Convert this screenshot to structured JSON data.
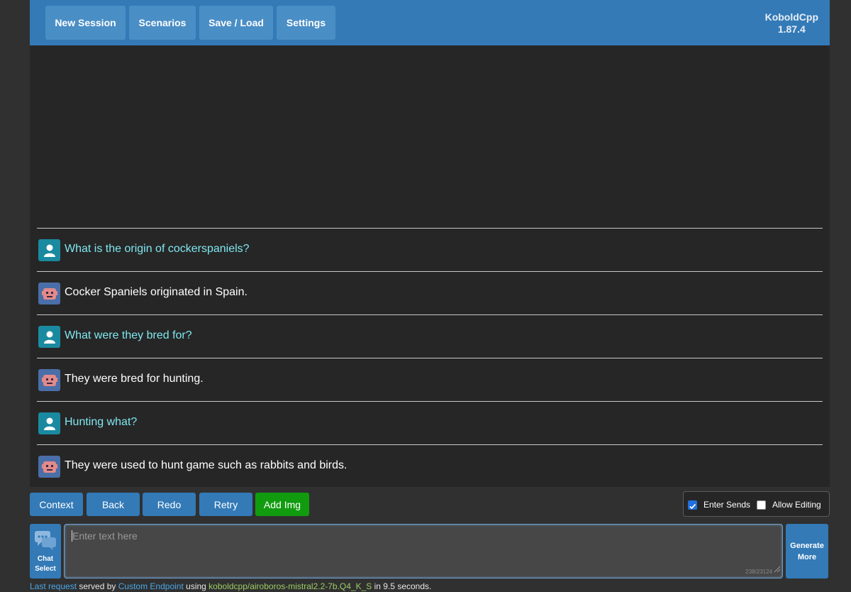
{
  "topbar": {
    "nav": [
      "New Session",
      "Scenarios",
      "Save / Load",
      "Settings"
    ],
    "brand_name": "KoboldCpp",
    "brand_version": "1.87.4"
  },
  "chat": {
    "messages": [
      {
        "role": "user",
        "text": "What is the origin of cockerspaniels?"
      },
      {
        "role": "bot",
        "text": "Cocker Spaniels originated in Spain."
      },
      {
        "role": "user",
        "text": "What were they bred for?"
      },
      {
        "role": "bot",
        "text": "They were bred for hunting."
      },
      {
        "role": "user",
        "text": "Hunting what?"
      },
      {
        "role": "bot",
        "text": "They were used to hunt game such as rabbits and birds."
      }
    ]
  },
  "actions": {
    "buttons": [
      "Context",
      "Back",
      "Redo",
      "Retry",
      "Add Img"
    ],
    "enter_sends_label": "Enter Sends",
    "enter_sends_checked": true,
    "allow_editing_label": "Allow Editing",
    "allow_editing_checked": false
  },
  "input": {
    "chat_select_line1": "Chat",
    "chat_select_line2": "Select",
    "placeholder": "Enter text here",
    "token_count": "238/23124",
    "generate_line1": "Generate",
    "generate_line2": "More"
  },
  "status": {
    "last_request": "Last request",
    "served_by": " served by ",
    "endpoint": "Custom Endpoint",
    "using": " using ",
    "model": "koboldcpp/airoboros-mistral2.2-7b.Q4_K_S",
    "duration": " in 9.5 seconds."
  },
  "colors": {
    "accent": "#337ab7",
    "green": "#119b0f",
    "user_text": "#7fe7f0",
    "background": "#262626"
  }
}
